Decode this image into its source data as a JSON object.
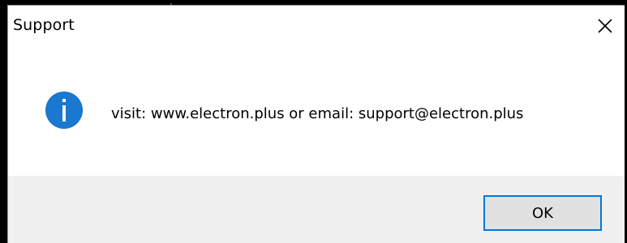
{
  "dialog": {
    "title": "Support",
    "message": "visit: www.electron.plus or email: support@electron.plus",
    "ok_label": "OK",
    "icon": "info-icon"
  },
  "colors": {
    "info_icon_fill": "#1a73c9",
    "button_border": "#0078d7",
    "footer_background": "#f0f0f0"
  }
}
